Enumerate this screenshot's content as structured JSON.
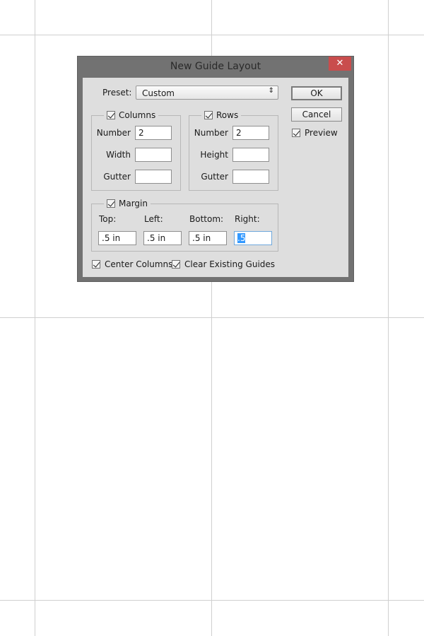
{
  "dialog": {
    "title": "New Guide Layout",
    "close_label": "✕",
    "preset": {
      "label": "Preset:",
      "value": "Custom"
    },
    "buttons": {
      "ok": "OK",
      "cancel": "Cancel"
    },
    "preview": {
      "label": "Preview",
      "checked": true
    },
    "columns": {
      "label": "Columns",
      "checked": true,
      "number_label": "Number",
      "number": "2",
      "width_label": "Width",
      "width": "",
      "gutter_label": "Gutter",
      "gutter": ""
    },
    "rows": {
      "label": "Rows",
      "checked": true,
      "number_label": "Number",
      "number": "2",
      "height_label": "Height",
      "height": "",
      "gutter_label": "Gutter",
      "gutter": ""
    },
    "margin": {
      "label": "Margin",
      "checked": true,
      "top_label": "Top:",
      "top": ".5 in",
      "left_label": "Left:",
      "left": ".5 in",
      "bottom_label": "Bottom:",
      "bottom": ".5 in",
      "right_label": "Right:",
      "right": ".5"
    },
    "center_columns": {
      "label": "Center Columns",
      "checked": true
    },
    "clear_guides": {
      "label": "Clear Existing Guides",
      "checked": true
    }
  }
}
